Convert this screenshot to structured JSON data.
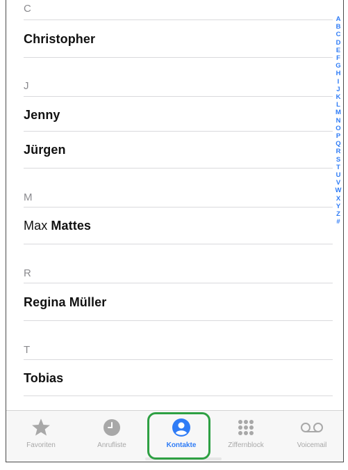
{
  "contacts_list": {
    "sections": [
      {
        "letter": "C",
        "contacts": [
          {
            "first": "Christopher",
            "last": ""
          }
        ]
      },
      {
        "letter": "J",
        "contacts": [
          {
            "first": "Jenny",
            "last": ""
          },
          {
            "first": "Jürgen",
            "last": ""
          }
        ]
      },
      {
        "letter": "M",
        "contacts": [
          {
            "first": "Max",
            "last": "Mattes"
          }
        ]
      },
      {
        "letter": "R",
        "contacts": [
          {
            "first": "Regina Müller",
            "last": ""
          }
        ]
      },
      {
        "letter": "T",
        "contacts": [
          {
            "first": "Tobias",
            "last": ""
          }
        ]
      }
    ]
  },
  "index_letters": [
    "A",
    "B",
    "C",
    "D",
    "E",
    "F",
    "G",
    "H",
    "I",
    "J",
    "K",
    "L",
    "M",
    "N",
    "O",
    "P",
    "Q",
    "R",
    "S",
    "T",
    "U",
    "V",
    "W",
    "X",
    "Y",
    "Z",
    "#"
  ],
  "tabbar": {
    "tabs": [
      {
        "label": "Favoriten",
        "icon": "star-icon",
        "active": false
      },
      {
        "label": "Anrufliste",
        "icon": "clock-icon",
        "active": false
      },
      {
        "label": "Kontakte",
        "icon": "person-circle-icon",
        "active": true
      },
      {
        "label": "Ziffernblock",
        "icon": "keypad-icon",
        "active": false
      },
      {
        "label": "Voicemail",
        "icon": "voicemail-icon",
        "active": false
      }
    ]
  },
  "colors": {
    "accent": "#2f7cf6",
    "highlight_border": "#2ea043",
    "inactive": "#a8a8a8"
  }
}
